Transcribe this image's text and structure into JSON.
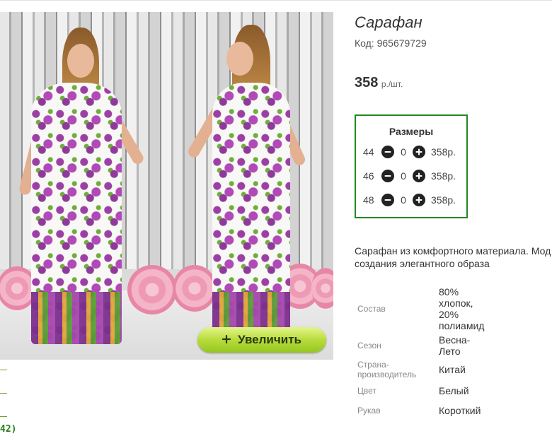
{
  "product": {
    "title": "Сарафан",
    "code": "Код: 965679729",
    "price": "358",
    "price_unit": "р./шт."
  },
  "zoom_button": {
    "icon": "plus-icon",
    "label": "Увеличить"
  },
  "sizes": {
    "title": "Размеры",
    "rows": [
      {
        "size": "44",
        "qty": "0",
        "price": "358р."
      },
      {
        "size": "46",
        "qty": "0",
        "price": "358р."
      },
      {
        "size": "48",
        "qty": "0",
        "price": "358р."
      }
    ]
  },
  "description": {
    "line1": "Сарафан из комфортного материала. Мод",
    "line2": "создания элегантного образа"
  },
  "attributes": {
    "composition": {
      "label": "Состав",
      "lines": [
        "80%",
        "хлопок,",
        "20%",
        "полиамид"
      ]
    },
    "season": {
      "label": "Сезон",
      "lines": [
        "Весна-",
        "Лето"
      ]
    },
    "country": {
      "label_lines": [
        "Страна-",
        "производитель"
      ],
      "value": "Китай"
    },
    "color": {
      "label": "Цвет",
      "value": "Белый"
    },
    "sleeve": {
      "label": "Рукав",
      "value": "Короткий"
    }
  },
  "left_fragment": {
    "count": "42)"
  },
  "colors": {
    "accent_green": "#1e8a1e",
    "button_green": "#b7dc3c"
  }
}
